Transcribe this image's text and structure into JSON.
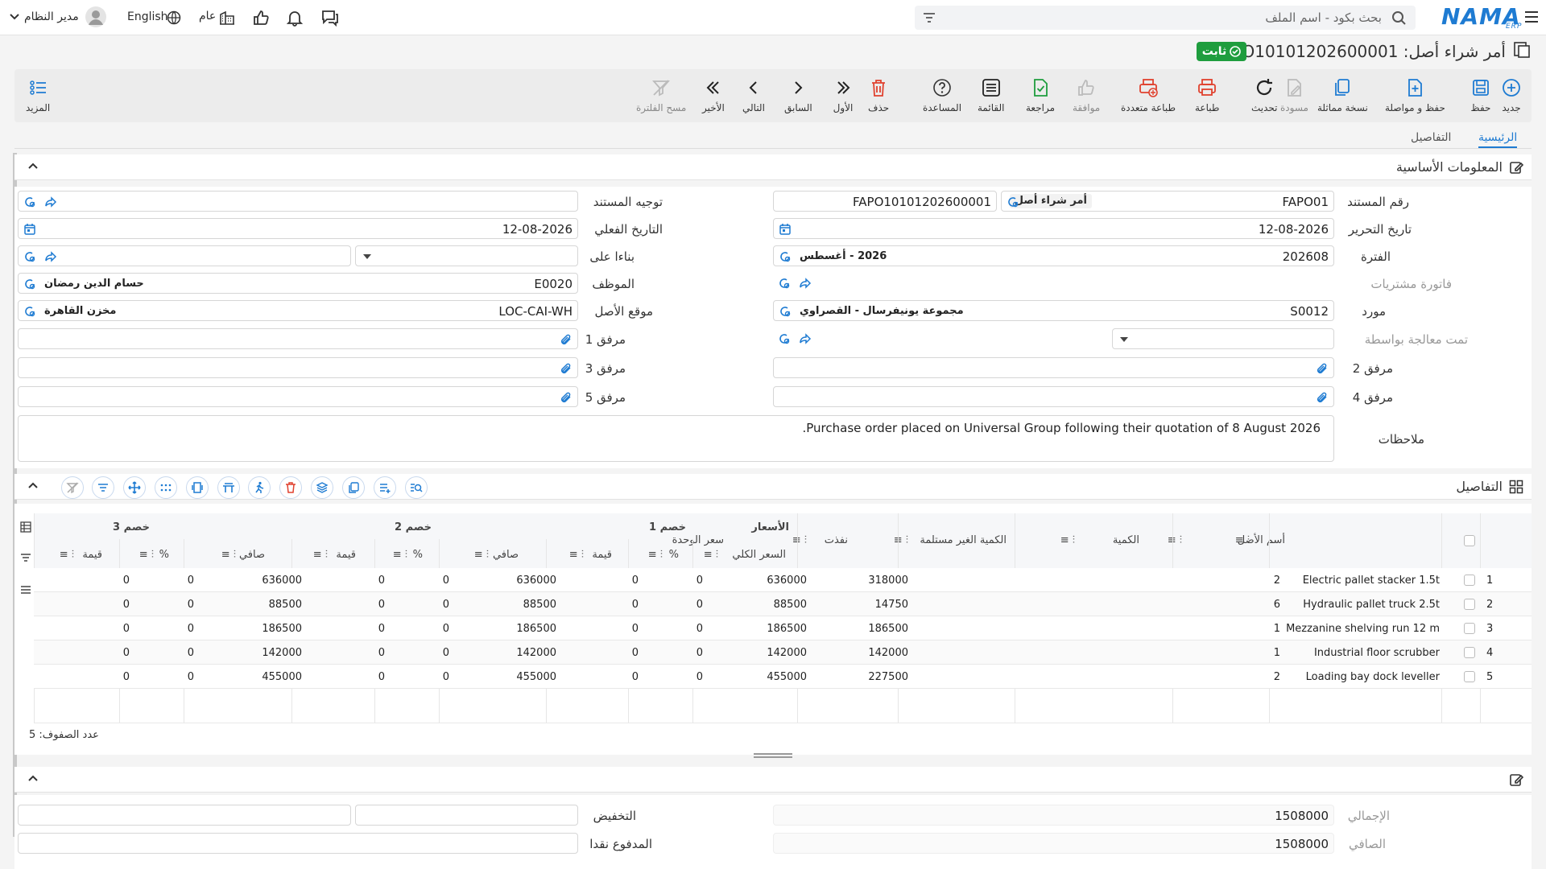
{
  "topbar": {
    "search_placeholder": "بحث بكود - اسم الملف",
    "logo": "NAMA",
    "logo_sub": "ERP",
    "language": "English",
    "scope": "عام",
    "user": "مدير النظام"
  },
  "title": {
    "text": "أمر شراء أصل: FAPO10101202600001",
    "status": "ثابت"
  },
  "toolbar": {
    "new": "جديد",
    "save": "حفظ",
    "save_continue": "حفظ و مواصلة",
    "copy": "نسخة مماثلة",
    "draft": "مسودة",
    "refresh": "تحديث",
    "print": "طباعة",
    "multi_print": "طباعة متعددة",
    "approve": "موافقة",
    "review": "مراجعة",
    "list": "القائمة",
    "help": "المساعدة",
    "delete": "حذف",
    "first": "الأول",
    "previous": "السابق",
    "next": "التالي",
    "last": "الأخير",
    "clear_filter": "مسح الفلترة",
    "more": "المزيد"
  },
  "tabs": {
    "main": "الرئيسية",
    "details": "التفاصيل"
  },
  "basic": {
    "title": "المعلومات الأساسية",
    "doc_number_label": "رقم المستند",
    "doc_number": "FAPO01",
    "doc_type": "أمر شراء أصل",
    "doc_code": "FAPO10101202600001",
    "doc_direction_label": "توجيه المستند",
    "date_label": "تاريخ التحرير",
    "date": "12-08-2026",
    "actual_date_label": "التاريخ الفعلي",
    "actual_date": "12-08-2026",
    "period_label": "الفترة",
    "period_code": "202608",
    "period_name": "2026 - أغسطس",
    "based_on_label": "بناءا على",
    "invoice_label": "فاتورة مشتريات",
    "employee_label": "الموظف",
    "employee_code": "E0020",
    "employee_name": "حسام الدين رمضان",
    "supplier_label": "مورد",
    "supplier_code": "S0012",
    "supplier_name": "مجموعة يونيفرسال - القصراوي",
    "location_label": "موقع الأصل",
    "location_code": "LOC-CAI-WH",
    "location_name": "مخزن القاهرة",
    "processed_label": "تمت معالجة بواسطة",
    "att1": "مرفق 1",
    "att2": "مرفق 2",
    "att3": "مرفق 3",
    "att4": "مرفق 4",
    "att5": "مرفق 5",
    "notes_label": "ملاحظات",
    "notes": "Purchase order placed on Universal Group following their quotation of 8 August 2026."
  },
  "details": {
    "title": "التفاصيل",
    "groups": {
      "prices": "الأسعار",
      "disc1": "خصم 1",
      "disc2": "خصم 2",
      "disc3": "خصم 3"
    },
    "headers": {
      "asset": "أسم الأصل",
      "qty": "الكمية",
      "unreceived": "الكمية الغير مستلمة",
      "executed": "نفذت",
      "unit_price": "سعر الوحدة",
      "total_price": "السعر الكلي",
      "pct": "%",
      "value": "قيمة",
      "net": "صافي"
    },
    "rows": [
      {
        "n": "1",
        "asset": "Electric pallet stacker 1.5t",
        "qty": "2",
        "unit": "318000",
        "total": "636000",
        "p1": "0",
        "v1": "0",
        "n1": "636000",
        "p2": "0",
        "v2": "0",
        "n2": "636000",
        "p3": "0",
        "v3": "0"
      },
      {
        "n": "2",
        "asset": "Hydraulic pallet truck 2.5t",
        "qty": "6",
        "unit": "14750",
        "total": "88500",
        "p1": "0",
        "v1": "0",
        "n1": "88500",
        "p2": "0",
        "v2": "0",
        "n2": "88500",
        "p3": "0",
        "v3": "0"
      },
      {
        "n": "3",
        "asset": "Mezzanine shelving run 12 m",
        "qty": "1",
        "unit": "186500",
        "total": "186500",
        "p1": "0",
        "v1": "0",
        "n1": "186500",
        "p2": "0",
        "v2": "0",
        "n2": "186500",
        "p3": "0",
        "v3": "0"
      },
      {
        "n": "4",
        "asset": "Industrial floor scrubber",
        "qty": "1",
        "unit": "142000",
        "total": "142000",
        "p1": "0",
        "v1": "0",
        "n1": "142000",
        "p2": "0",
        "v2": "0",
        "n2": "142000",
        "p3": "0",
        "v3": "0"
      },
      {
        "n": "5",
        "asset": "Loading bay dock leveller",
        "qty": "2",
        "unit": "227500",
        "total": "455000",
        "p1": "0",
        "v1": "0",
        "n1": "455000",
        "p2": "0",
        "v2": "0",
        "n2": "455000",
        "p3": "0",
        "v3": "0"
      }
    ],
    "row_count": "عدد الصفوف: 5"
  },
  "totals": {
    "total_label": "الإجمالي",
    "total": "1508000",
    "net_label": "الصافي",
    "net": "1508000",
    "discount_label": "التخفيض",
    "cash_label": "المدفوع نقدا"
  },
  "colors": {
    "accent": "#1e7bd2",
    "status": "#1f9d3e",
    "danger": "#e0412e"
  }
}
